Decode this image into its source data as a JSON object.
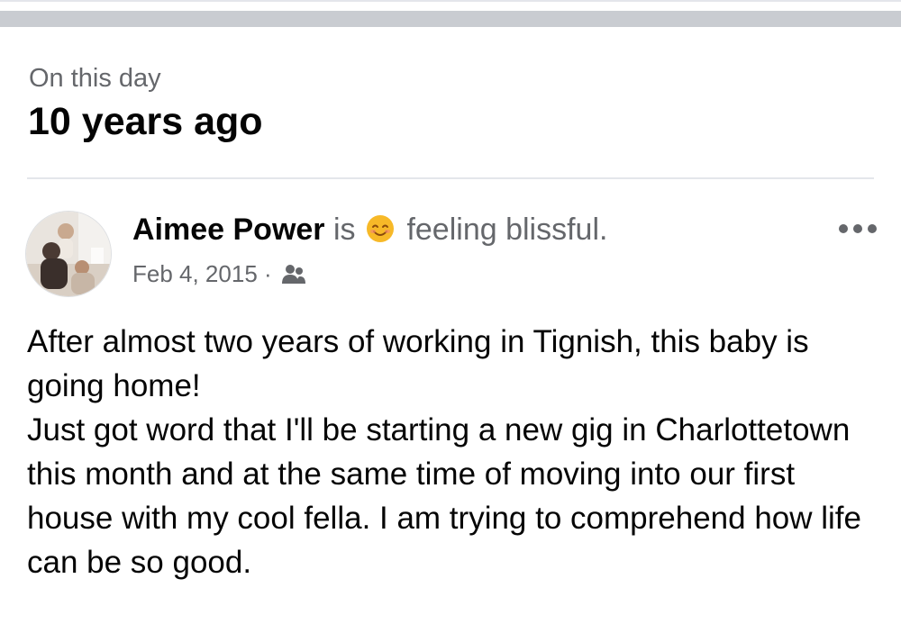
{
  "memory_header": {
    "kicker": "On this day",
    "title": "10 years ago"
  },
  "post": {
    "author": "Aimee Power",
    "is_text": "is",
    "feeling_text": "feeling blissful.",
    "feeling_icon": "smiling-face-emoji",
    "date": "Feb 4, 2015",
    "separator": "·",
    "audience_icon": "friends-icon",
    "more_icon": "more-options-icon",
    "body_lines": [
      "After almost two years of working in Tignish, this baby is going home!",
      "Just got word that I'll be starting a new gig in Charlottetown this month and at the same time of moving into our first house with my cool fella. I am trying to comprehend how life can be so good."
    ]
  },
  "colors": {
    "primary_text": "#050505",
    "secondary_text": "#65676b",
    "divider": "#e4e6eb",
    "top_bar": "#c9ccd1",
    "emoji_yellow": "#f7b928"
  }
}
